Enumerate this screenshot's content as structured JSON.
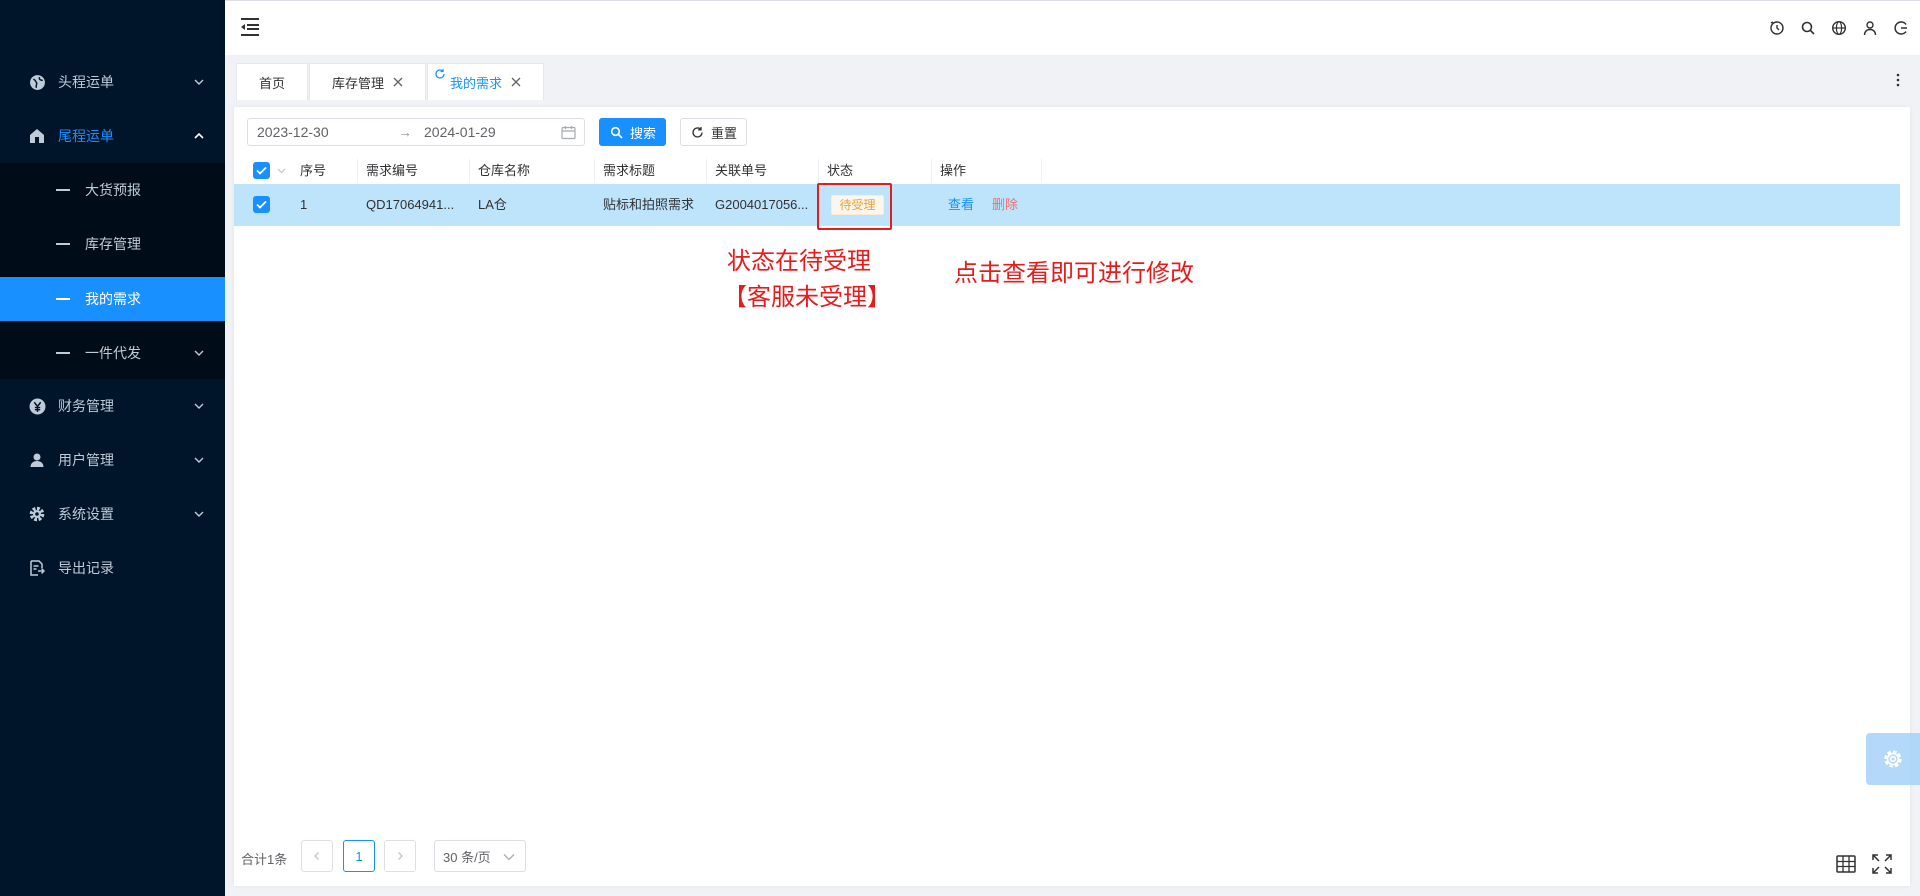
{
  "sidebar": {
    "items": [
      {
        "label": "头程运单",
        "icon": "globe-icon"
      },
      {
        "label": "尾程运单",
        "icon": "home-icon"
      },
      {
        "label": "财务管理",
        "icon": "yen-icon"
      },
      {
        "label": "用户管理",
        "icon": "user-icon"
      },
      {
        "label": "系统设置",
        "icon": "gear-icon"
      },
      {
        "label": "导出记录",
        "icon": "export-file-icon"
      }
    ],
    "subitems": [
      {
        "label": "大货预报"
      },
      {
        "label": "库存管理"
      },
      {
        "label": "我的需求"
      },
      {
        "label": "一件代发"
      }
    ]
  },
  "tabs": [
    {
      "label": "首页"
    },
    {
      "label": "库存管理"
    },
    {
      "label": "我的需求"
    }
  ],
  "filters": {
    "date_start": "2023-12-30",
    "date_sep": "→",
    "date_end": "2024-01-29",
    "search_label": "搜索",
    "reset_label": "重置"
  },
  "table": {
    "headers": [
      "序号",
      "需求编号",
      "仓库名称",
      "需求标题",
      "关联单号",
      "状态",
      "操作"
    ],
    "rows": [
      {
        "index": "1",
        "req_no": "QD17064941...",
        "warehouse": "LA仓",
        "title": "贴标和拍照需求",
        "ref_no": "G2004017056...",
        "status": "待受理",
        "action_view": "查看",
        "action_delete": "删除"
      }
    ]
  },
  "annotations": {
    "status_note_line1": "状态在待受理",
    "status_note_line2": "【客服未受理】",
    "action_note": "点击查看即可进行修改"
  },
  "pagination": {
    "total": "合计1条",
    "current_page": "1",
    "page_size": "30 条/页"
  },
  "colors": {
    "primary": "#1890ff",
    "sidebar_bg": "#001529",
    "danger": "#f56c6c",
    "warning": "#e6a23c",
    "annotation": "#e61c1c"
  }
}
